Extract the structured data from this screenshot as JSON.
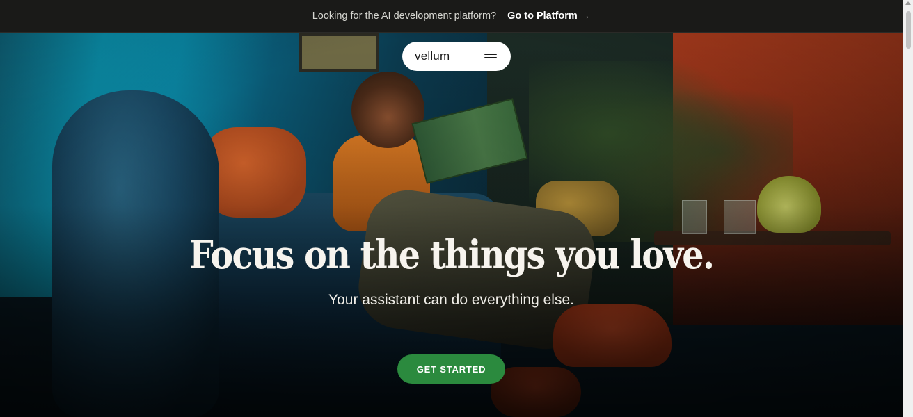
{
  "announcement": {
    "text": "Looking for the AI development platform?",
    "link_label": "Go to Platform",
    "link_arrow": "→"
  },
  "nav": {
    "logo": "vellum",
    "menu_icon": "hamburger-menu-icon"
  },
  "hero": {
    "headline": "Focus on the things you love.",
    "subheadline": "Your assistant can do everything else.",
    "cta_label": "GET STARTED",
    "cta_color": "#2b8a3e"
  }
}
